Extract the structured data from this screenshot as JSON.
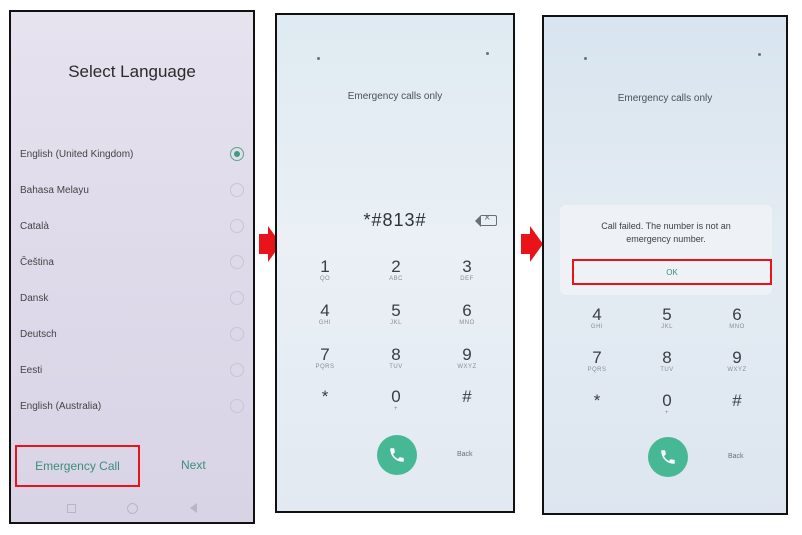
{
  "select_language": {
    "title": "Select Language",
    "languages": [
      {
        "label": "English (United Kingdom)",
        "selected": true
      },
      {
        "label": "Bahasa Melayu",
        "selected": false
      },
      {
        "label": "Català",
        "selected": false
      },
      {
        "label": "Čeština",
        "selected": false
      },
      {
        "label": "Dansk",
        "selected": false
      },
      {
        "label": "Deutsch",
        "selected": false
      },
      {
        "label": "Eesti",
        "selected": false
      },
      {
        "label": "English (Australia)",
        "selected": false
      }
    ],
    "emergency_call_label": "Emergency Call",
    "next_label": "Next"
  },
  "dialer": {
    "status_label": "Emergency calls only",
    "entered_code": "*#813#",
    "keys": [
      {
        "digit": "1",
        "sub": "QO"
      },
      {
        "digit": "2",
        "sub": "ABC"
      },
      {
        "digit": "3",
        "sub": "DEF"
      },
      {
        "digit": "4",
        "sub": "GHI"
      },
      {
        "digit": "5",
        "sub": "JKL"
      },
      {
        "digit": "6",
        "sub": "MNO"
      },
      {
        "digit": "7",
        "sub": "PQRS"
      },
      {
        "digit": "8",
        "sub": "TUV"
      },
      {
        "digit": "9",
        "sub": "WXYZ"
      },
      {
        "digit": "*",
        "sub": ""
      },
      {
        "digit": "0",
        "sub": "+"
      },
      {
        "digit": "#",
        "sub": ""
      }
    ],
    "back_label": "Back"
  },
  "call_failed": {
    "status_label": "Emergency calls only",
    "dialog_message": "Call failed. The number is not an emergency number.",
    "ok_label": "OK"
  },
  "colors": {
    "accent": "#3e8d7a",
    "call_button": "#46b894",
    "highlight": "#e8141a"
  },
  "icons": {
    "call": "phone-icon",
    "backspace": "backspace-icon",
    "arrow": "arrow-right-icon"
  }
}
